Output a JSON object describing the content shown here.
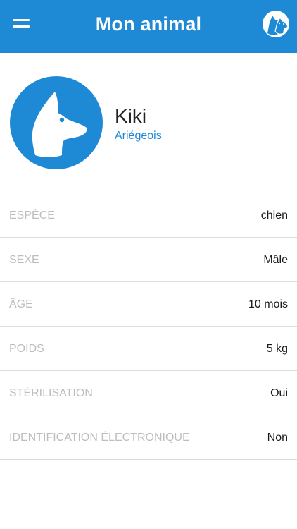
{
  "header": {
    "title": "Mon animal",
    "menu_icon": "hamburger-menu-icon",
    "logo_icon": "dog-logo-icon",
    "color": "#1e8ad6"
  },
  "pet": {
    "name": "Kiki",
    "breed": "Ariégeois",
    "avatar_icon": "dog-head-icon"
  },
  "details": [
    {
      "label": "ESPÈCE",
      "value": "chien"
    },
    {
      "label": "SEXE",
      "value": "Mâle"
    },
    {
      "label": "ÂGE",
      "value": "10 mois"
    },
    {
      "label": "POIDS",
      "value": "5 kg"
    },
    {
      "label": "STÉRILISATION",
      "value": "Oui"
    },
    {
      "label": "IDENTIFICATION ÉLECTRONIQUE",
      "value": "Non"
    }
  ],
  "colors": {
    "accent": "#1e8ad6",
    "label": "#bdbdbd",
    "value": "#1a1a1a",
    "divider": "#dcdcdc"
  }
}
